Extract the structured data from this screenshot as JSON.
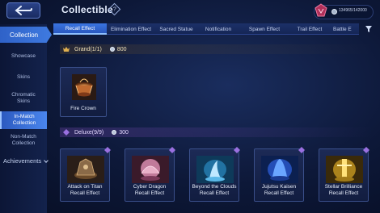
{
  "header": {
    "title": "Collectible",
    "help_symbol": "?",
    "currency": "134965/142000"
  },
  "sidebar": {
    "main_label": "Collection",
    "items": [
      {
        "label": "Showcase",
        "active": false
      },
      {
        "label": "Skins",
        "active": false
      },
      {
        "label": "Chromatic Skins",
        "active": false
      },
      {
        "label": "In-Match Collection",
        "active": true
      },
      {
        "label": "Non-Match Collection",
        "active": false
      }
    ],
    "achievements_label": "Achievements"
  },
  "tabs": [
    {
      "label": "Recall Effect",
      "active": true
    },
    {
      "label": "Elimination Effect",
      "active": false
    },
    {
      "label": "Sacred Statue",
      "active": false
    },
    {
      "label": "Notification",
      "active": false
    },
    {
      "label": "Spawn Effect",
      "active": false
    },
    {
      "label": "Trail Effect",
      "active": false
    },
    {
      "label": "Battle E",
      "active": false
    }
  ],
  "groups": {
    "grand": {
      "label": "Grand(1/1)",
      "points": "800",
      "items": [
        {
          "name": "Fire Crown"
        }
      ]
    },
    "deluxe": {
      "label": "Deluxe(9/9)",
      "points": "300",
      "items": [
        {
          "name": "Attack on Titan Recall Effect"
        },
        {
          "name": "Cyber Dragon Recall Effect"
        },
        {
          "name": "Beyond the Clouds Recall Effect"
        },
        {
          "name": "Jujutsu Kaisen Recall Effect"
        },
        {
          "name": "Stellar Brilliance Recall Effect"
        }
      ]
    }
  },
  "colors": {
    "accent": "#3a74e0",
    "grand_gold": "#e0b050",
    "deluxe_purple": "#9a70e0"
  }
}
